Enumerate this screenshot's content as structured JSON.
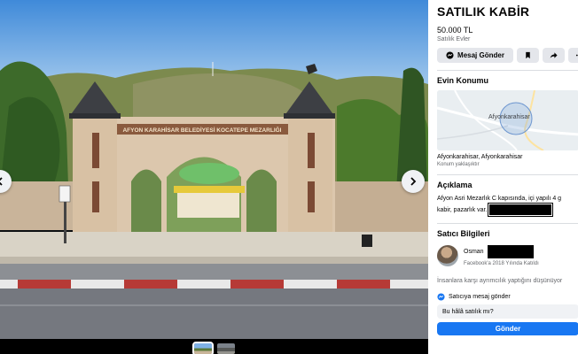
{
  "listing": {
    "title": "SATILIK KABİR",
    "price": "50.000 TL",
    "category": "Satılık Evler"
  },
  "actions": {
    "message_label": "Mesaj Gönder",
    "icons": [
      "messenger-icon",
      "bookmark-icon",
      "share-icon",
      "more-icon"
    ]
  },
  "location": {
    "section_title": "Evin Konumu",
    "map_label": "Afyonkarahisar",
    "place": "Afyonkarahisar, Afyonkarahisar",
    "approx": "Konum yaklaşıktır"
  },
  "description": {
    "section_title": "Açıklama",
    "text_line1": "Afyon Asri Mezarlık C kapısında, içi yapılı 4 g",
    "text_line2": "kabir, pazarlık var."
  },
  "seller": {
    "section_title": "Satıcı Bilgileri",
    "name": "Osman",
    "joined": "Facebook'a 2018 Yılında Katıldı"
  },
  "notice": "İnsanlara karşı ayrımcılık yaptığını düşünüyor",
  "message": {
    "prompt": "Satıcıya mesaj gönder",
    "input_value": "Bu hâlâ satılık mı?",
    "send_label": "Gönder"
  },
  "photo": {
    "sign_text": "AFYON KARAHİSAR BELEDİYESİ KOCATEPE MEZARLIĞI",
    "colors": {
      "sky": "#6fa7df",
      "wall": "#dcc7ad",
      "roof": "#3d3f44",
      "road": "#7d8088",
      "curb_red": "#b63a36"
    }
  }
}
